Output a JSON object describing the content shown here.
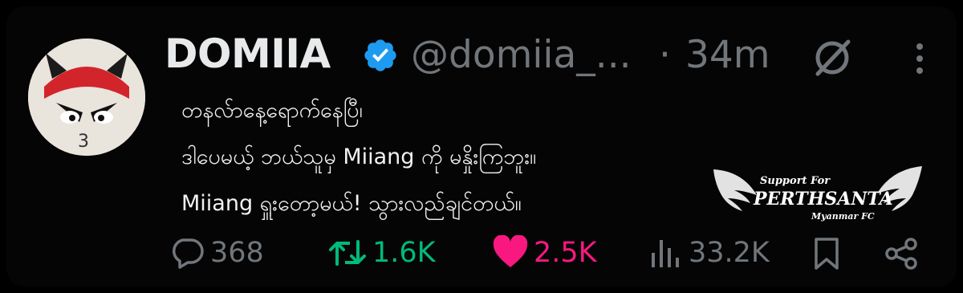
{
  "tweet": {
    "author_name": "DOMIIA",
    "handle": "@domiia_...",
    "separator": "·",
    "time": "34m",
    "lines": [
      "တနလ်ာနေ့ရောက်နေပြီ၊",
      "ဒါပေမယ့် ဘယ်သူမှ Miiang ကို မနှိုးကြဘူး။",
      "Miiang ရှူးတော့မယ်! သွားလည်ချင်တယ်။"
    ]
  },
  "actions": {
    "replies": "368",
    "reposts": "1.6K",
    "likes": "2.5K",
    "views": "33.2K"
  },
  "watermark": {
    "line1": "Support For",
    "line2": "PERTHSANTA",
    "line3": "Myanmar FC"
  },
  "icons": [
    "verified-badge-icon",
    "grok-icon",
    "more-icon",
    "reply-icon",
    "repost-icon",
    "heart-icon",
    "views-icon",
    "bookmark-icon",
    "share-icon"
  ],
  "colors": {
    "background": "#000000",
    "text": "#e7e9ea",
    "muted": "#71767b",
    "verified": "#1d9bf0",
    "repost": "#00ba7c",
    "like": "#f91880"
  }
}
